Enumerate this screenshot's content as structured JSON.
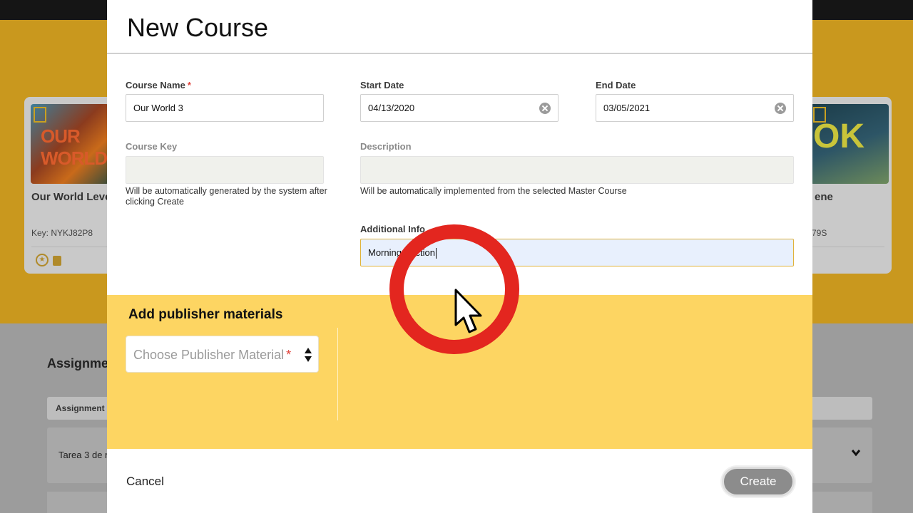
{
  "background": {
    "cards": [
      {
        "title": "Our World Leve",
        "key": "Key: NYKJ82P8",
        "cover_text": "OUR WORLD"
      },
      {
        "title": "ene",
        "key": "79S",
        "cover_text": "OK"
      }
    ],
    "section_heading": "Assignme",
    "table_header": "Assignment n",
    "table_row": "Tarea 3 de n"
  },
  "modal": {
    "title": "New Course",
    "fields": {
      "course_name": {
        "label": "Course Name",
        "required_mark": "*",
        "value": "Our World 3"
      },
      "start_date": {
        "label": "Start Date",
        "value": "04/13/2020"
      },
      "end_date": {
        "label": "End Date",
        "value": "03/05/2021"
      },
      "course_key": {
        "label": "Course Key",
        "value": "",
        "help": "Will be automatically generated by the system after clicking Create"
      },
      "description": {
        "label": "Description",
        "value": "",
        "help": "Will be automatically implemented from the selected Master Course"
      },
      "additional_info": {
        "label": "Additional Info",
        "value": "Morning Section"
      }
    },
    "publisher": {
      "title": "Add publisher materials",
      "select_placeholder": "Choose Publisher Material",
      "required_mark": "*"
    },
    "footer": {
      "cancel_label": "Cancel",
      "create_label": "Create"
    }
  },
  "colors": {
    "accent_yellow": "#fdd562",
    "required_red": "#e0433b",
    "click_ring": "#e3261f",
    "create_button": "#8c8c8c"
  }
}
